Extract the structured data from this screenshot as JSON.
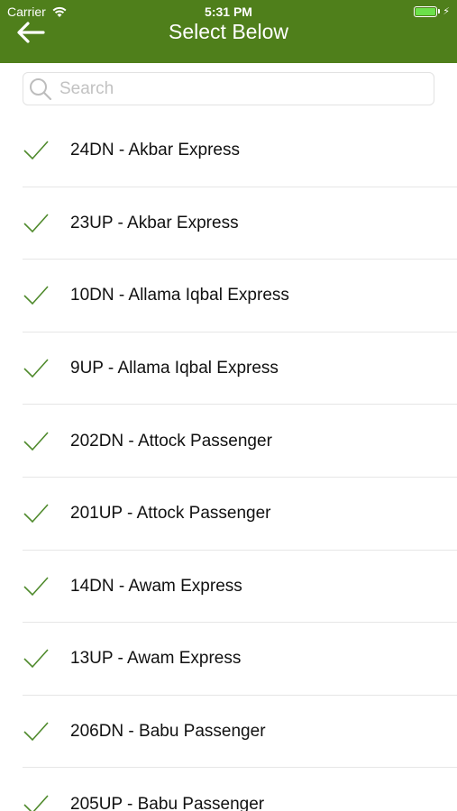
{
  "status_bar": {
    "carrier": "Carrier",
    "time": "5:31 PM"
  },
  "header": {
    "title": "Select Below",
    "back_icon": "back-arrow-icon"
  },
  "search": {
    "placeholder": "Search",
    "value": ""
  },
  "colors": {
    "header_bg": "#4f7f1b",
    "check": "#4f8a2c"
  },
  "trains": [
    {
      "label": "24DN - Akbar Express",
      "checked": true
    },
    {
      "label": "23UP - Akbar Express",
      "checked": true
    },
    {
      "label": "10DN - Allama Iqbal Express",
      "checked": true
    },
    {
      "label": "9UP - Allama Iqbal Express",
      "checked": true
    },
    {
      "label": "202DN - Attock Passenger",
      "checked": true
    },
    {
      "label": "201UP - Attock Passenger",
      "checked": true
    },
    {
      "label": "14DN - Awam Express",
      "checked": true
    },
    {
      "label": "13UP - Awam Express",
      "checked": true
    },
    {
      "label": "206DN - Babu Passenger",
      "checked": true
    },
    {
      "label": "205UP - Babu Passenger",
      "checked": true
    }
  ]
}
